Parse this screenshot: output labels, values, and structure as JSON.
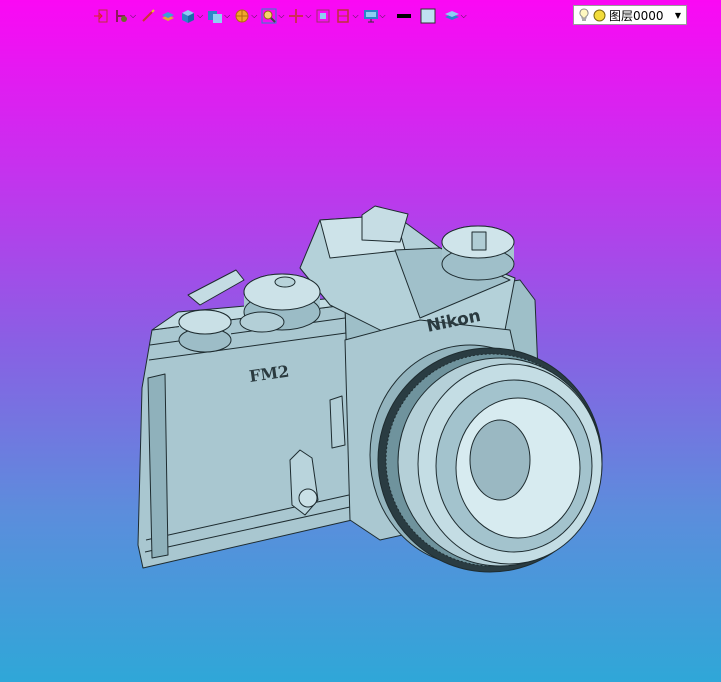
{
  "toolbar": {
    "buttons": [
      {
        "name": "import-icon",
        "dropdown": false
      },
      {
        "name": "sketch-tool-icon",
        "dropdown": true
      },
      {
        "name": "edit-pen-icon",
        "dropdown": false
      },
      {
        "name": "extrude-icon",
        "dropdown": false
      },
      {
        "name": "solid-box-icon",
        "dropdown": true
      },
      {
        "name": "boolean-icon",
        "dropdown": true
      },
      {
        "name": "sphere-icon",
        "dropdown": true
      },
      {
        "name": "zoom-icon",
        "dropdown": true
      },
      {
        "name": "pan-move-icon",
        "dropdown": true
      },
      {
        "name": "fit-view-icon",
        "dropdown": false
      },
      {
        "name": "section-view-icon",
        "dropdown": true
      },
      {
        "name": "display-monitor-icon",
        "dropdown": true
      },
      {
        "name": "line-color-icon",
        "dropdown": false
      },
      {
        "name": "fill-color-icon",
        "dropdown": false
      },
      {
        "name": "layer-stack-icon",
        "dropdown": true
      }
    ]
  },
  "layer": {
    "current": "图层0000"
  },
  "colors": {
    "background_top": "#fb08f4",
    "background_bottom": "#2fa7d8",
    "model_fill": "#a7c6cf",
    "model_edge": "#1e2c30"
  }
}
